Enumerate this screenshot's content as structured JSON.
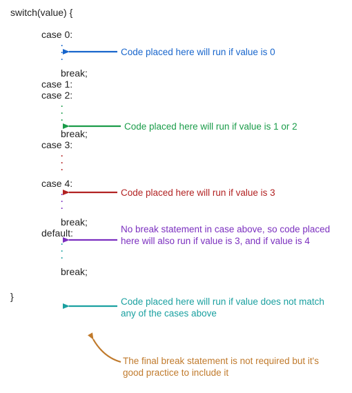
{
  "code": {
    "switch_line": "switch(value) {",
    "case0": "case 0:",
    "case1": "case 1:",
    "case2": "case 2:",
    "case3": "case 3:",
    "case4": "case 4:",
    "default": "default:",
    "break": "break;",
    "close": "}"
  },
  "annotations": {
    "a0": "Code placed here will run if value is 0",
    "a12": "Code placed here will run if value is 1 or 2",
    "a3": "Code placed here will run if value is 3",
    "a4": "No break statement in case above, so code placed here will also run if value is 3, and if value is 4",
    "adefault": "Code placed here will run if value does not match any of the cases above",
    "afinal": "The final break statement is not required but it's good practice to include it"
  },
  "colors": {
    "c0": "#1765cc",
    "c12": "#1a9c49",
    "c3": "#b22222",
    "c4": "#7b2fbf",
    "cdefault": "#1aa0a0",
    "cfinal": "#c07a2c"
  }
}
